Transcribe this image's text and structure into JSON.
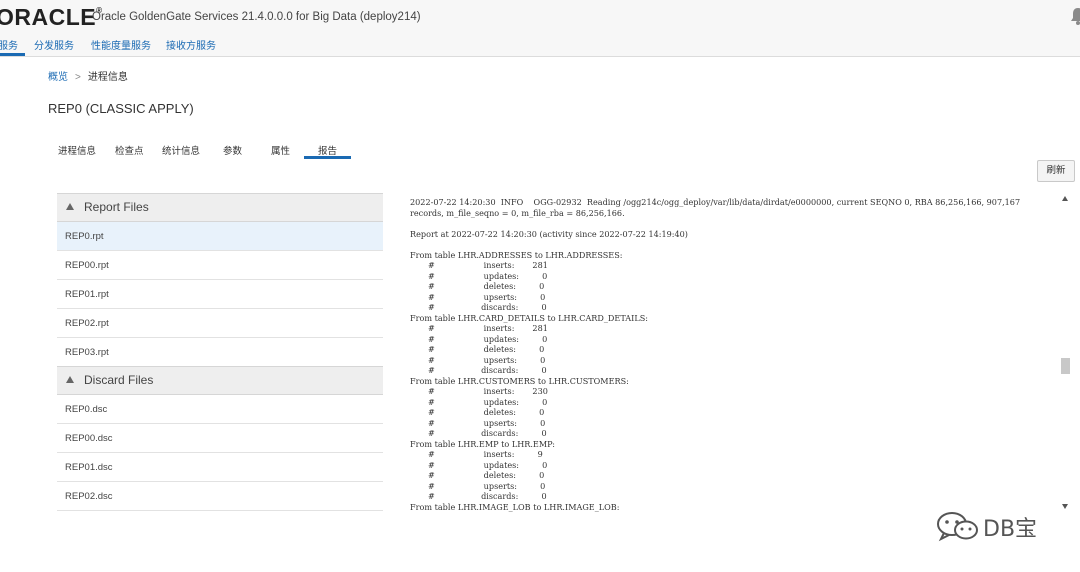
{
  "header": {
    "logo_text": "ORACLE",
    "app_title": "Oracle GoldenGate Services 21.4.0.0.0 for Big Data (deploy214)"
  },
  "nav": {
    "items": [
      {
        "label": "服务"
      },
      {
        "label": "分发服务"
      },
      {
        "label": "性能度量服务"
      },
      {
        "label": "接收方服务"
      }
    ]
  },
  "breadcrumb": {
    "home": "概览",
    "separator": ">",
    "current": "进程信息"
  },
  "page_title": "REP0 (CLASSIC APPLY)",
  "tabs": [
    {
      "label": "进程信息"
    },
    {
      "label": "检查点"
    },
    {
      "label": "统计信息"
    },
    {
      "label": "参数"
    },
    {
      "label": "属性"
    },
    {
      "label": "报告",
      "active": true
    }
  ],
  "refresh_label": "刷新",
  "report_files": {
    "title": "Report Files",
    "files": [
      "REP0.rpt",
      "REP00.rpt",
      "REP01.rpt",
      "REP02.rpt",
      "REP03.rpt"
    ],
    "selected": "REP0.rpt"
  },
  "discard_files": {
    "title": "Discard Files",
    "files": [
      "REP0.dsc",
      "REP00.dsc",
      "REP01.dsc",
      "REP02.dsc"
    ]
  },
  "report_text": "2022-07-22 14:20:30  INFO    OGG-02932  Reading /ogg214c/ogg_deploy/var/lib/data/dirdat/e0000000, current SEQNO 0, RBA 86,256,166, 907,167\nrecords, m_file_seqno = 0, m_file_rba = 86,256,166.\n\nReport at 2022-07-22 14:20:30 (activity since 2022-07-22 14:19:40)\n\nFrom table LHR.ADDRESSES to LHR.ADDRESSES:\n       #                   inserts:       281\n       #                   updates:         0\n       #                   deletes:         0\n       #                   upserts:         0\n       #                  discards:         0\nFrom table LHR.CARD_DETAILS to LHR.CARD_DETAILS:\n       #                   inserts:       281\n       #                   updates:         0\n       #                   deletes:         0\n       #                   upserts:         0\n       #                  discards:         0\nFrom table LHR.CUSTOMERS to LHR.CUSTOMERS:\n       #                   inserts:       230\n       #                   updates:         0\n       #                   deletes:         0\n       #                   upserts:         0\n       #                  discards:         0\nFrom table LHR.EMP to LHR.EMP:\n       #                   inserts:         9\n       #                   updates:         0\n       #                   deletes:         0\n       #                   upserts:         0\n       #                  discards:         0\nFrom table LHR.IMAGE_LOB to LHR.IMAGE_LOB:",
  "watermark": "DB宝",
  "icons": {
    "bell": "bell-icon",
    "group_toggle": "triangle-up-icon",
    "scroll_up": "scroll-up-icon",
    "scroll_down": "scroll-down-icon",
    "watermark": "wechat-icon"
  },
  "colors": {
    "accent": "#1a6ab3",
    "selected_row": "#e8f2fb",
    "header_bg": "#f7f7f7"
  }
}
